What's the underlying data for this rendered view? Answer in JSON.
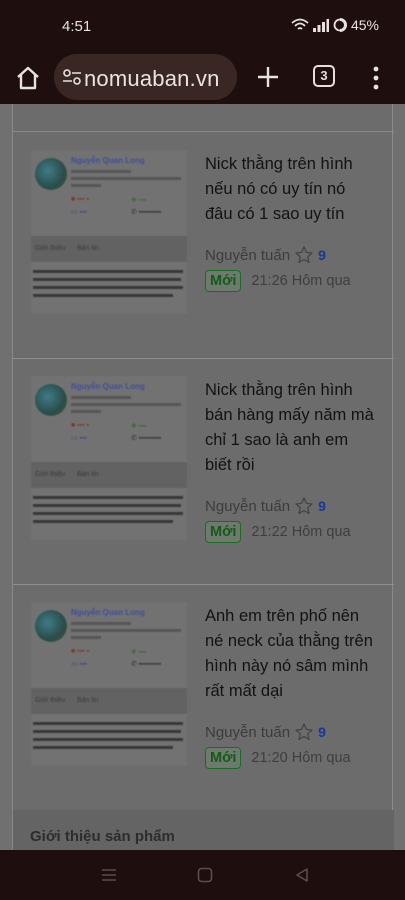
{
  "status": {
    "time": "4:51",
    "battery": "45%"
  },
  "browser": {
    "url": "nomuaban.vn",
    "tab_count": "3"
  },
  "posts": [
    {
      "title": "Nick thằng trên hình nếu nó có uy tín nó đâu có 1 sao uy tín",
      "author": "Nguyễn tuấn",
      "score": "9",
      "badge": "Mới",
      "time": "21:26 Hôm qua"
    },
    {
      "title": "Nick thằng trên hình bán hàng mấy năm mà chỉ 1 sao là anh em biết rồi",
      "author": "Nguyễn tuấn",
      "score": "9",
      "badge": "Mới",
      "time": "21:22 Hôm qua"
    },
    {
      "title": "Anh em trên phố nên né neck của thằng trên hình này nó sâm mình rất mất dại",
      "author": "Nguyễn tuấn",
      "score": "9",
      "badge": "Mới",
      "time": "21:20 Hôm qua"
    }
  ],
  "thumbnail": {
    "name": "Nguyễn Quan Long",
    "tab1": "Giới thiệu",
    "tab2": "Bán tin"
  },
  "section": {
    "title": "Giới thiệu sản phẩm"
  }
}
